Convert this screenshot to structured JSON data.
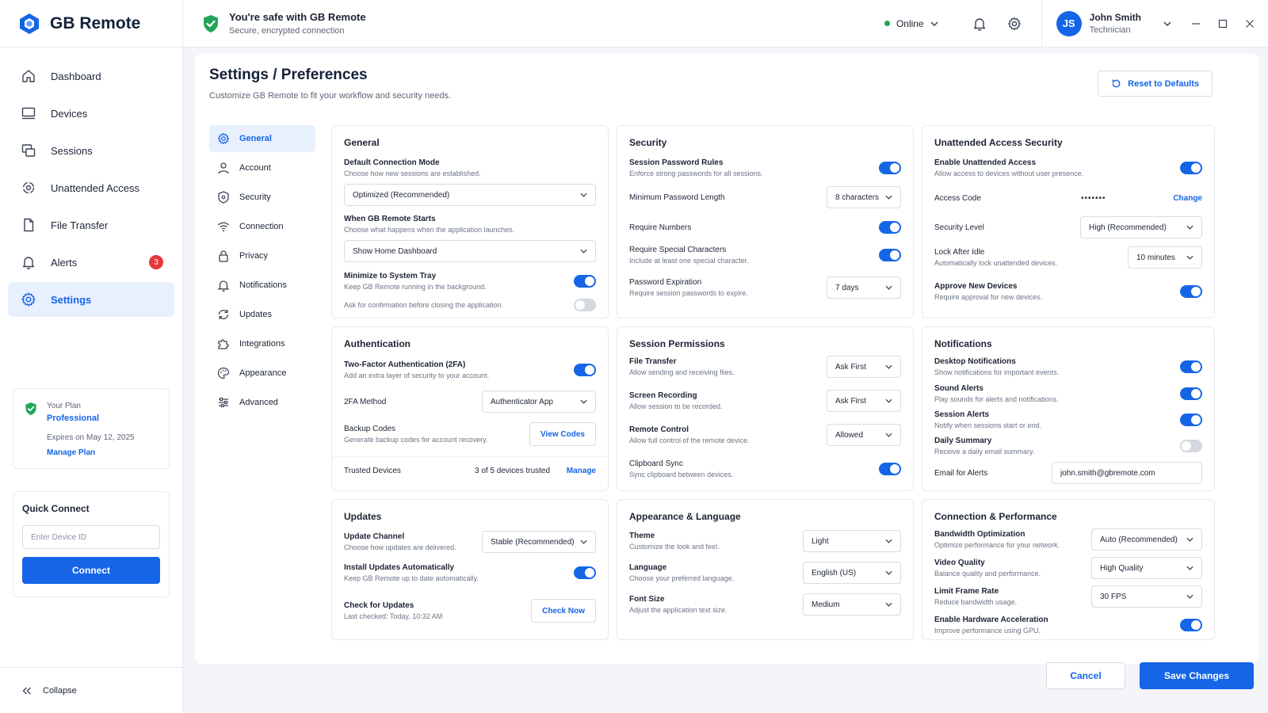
{
  "app": {
    "name": "GB Remote"
  },
  "security_banner": {
    "title": "You're safe with GB Remote",
    "subtitle": "Secure, encrypted connection"
  },
  "status": {
    "label": "Online",
    "color": "#23a55a"
  },
  "user": {
    "initials": "JS",
    "name": "John Smith",
    "role": "Technician"
  },
  "colors": {
    "accent": "#1565e6",
    "alert": "#e5383b"
  },
  "sidebar": {
    "items": [
      {
        "label": "Dashboard",
        "icon": "home-icon"
      },
      {
        "label": "Devices",
        "icon": "monitor-icon"
      },
      {
        "label": "Sessions",
        "icon": "sessions-icon"
      },
      {
        "label": "Unattended Access",
        "icon": "unattended-icon"
      },
      {
        "label": "File Transfer",
        "icon": "file-icon"
      },
      {
        "label": "Alerts",
        "icon": "bell-icon",
        "badge": "3"
      },
      {
        "label": "Settings",
        "icon": "gear-icon",
        "active": true
      }
    ],
    "plan": {
      "label": "Your Plan",
      "value": "Professional",
      "expires": "Expires on May 12, 2025",
      "manage": "Manage Plan"
    },
    "quick_connect": {
      "title": "Quick Connect",
      "placeholder": "Enter Device ID",
      "button": "Connect"
    },
    "collapse": "Collapse"
  },
  "page": {
    "title": "Settings / Preferences",
    "subtitle": "Customize GB Remote to fit your workflow and security needs.",
    "reset": "Reset to Defaults"
  },
  "subnav": [
    "General",
    "Account",
    "Security",
    "Connection",
    "Privacy",
    "Notifications",
    "Updates",
    "Integrations",
    "Appearance",
    "Advanced"
  ],
  "general": {
    "title": "General",
    "mode_label": "Default Connection Mode",
    "mode_desc": "Choose how new sessions are established.",
    "mode_value": "Optimized (Recommended)",
    "start_label": "When GB Remote Starts",
    "start_desc": "Choose what happens when the application launches.",
    "start_value": "Show Home Dashboard",
    "tray_label": "Minimize to System Tray",
    "tray_desc": "Keep GB Remote running in the background.",
    "tray_on": true,
    "confirm_label": "Ask for confirmation before closing the application.",
    "confirm_on": false
  },
  "security": {
    "title": "Security",
    "rules_label": "Session Password Rules",
    "rules_desc": "Enforce strong passwords for all sessions.",
    "rules_on": true,
    "min_label": "Minimum Password Length",
    "min_value": "8 characters",
    "num_label": "Require Numbers",
    "num_on": true,
    "special_label": "Require Special Characters",
    "special_desc": "Include at least one special character.",
    "special_on": true,
    "exp_label": "Password Expiration",
    "exp_desc": "Require session passwords to expire.",
    "exp_value": "7 days"
  },
  "unattended": {
    "title": "Unattended Access Security",
    "enable_label": "Enable Unattended Access",
    "enable_desc": "Allow access to devices without user presence.",
    "enable_on": true,
    "code_label": "Access Code",
    "code_value": "•••••••",
    "code_action": "Change",
    "level_label": "Security Level",
    "level_value": "High (Recommended)",
    "lock_label": "Lock After Idle",
    "lock_desc": "Automatically lock unattended devices.",
    "lock_value": "10 minutes",
    "approve_label": "Approve New Devices",
    "approve_desc": "Require approval for new devices.",
    "approve_on": true
  },
  "auth": {
    "title": "Authentication",
    "twofa_label": "Two-Factor Authentication (2FA)",
    "twofa_desc": "Add an extra layer of security to your account.",
    "twofa_on": true,
    "method_label": "2FA Method",
    "method_value": "Authenticator App",
    "backup_label": "Backup Codes",
    "backup_desc": "Generate backup codes for account recovery.",
    "backup_button": "View Codes",
    "trusted_label": "Trusted Devices",
    "trusted_value": "3 of 5 devices trusted",
    "trusted_action": "Manage"
  },
  "permissions": {
    "title": "Session Permissions",
    "file_label": "File Transfer",
    "file_desc": "Allow sending and receiving files.",
    "file_value": "Ask First",
    "rec_label": "Screen Recording",
    "rec_desc": "Allow session to be recorded.",
    "rec_value": "Ask First",
    "rc_label": "Remote Control",
    "rc_desc": "Allow full control of the remote device.",
    "rc_value": "Allowed",
    "clip_label": "Clipboard Sync",
    "clip_desc": "Sync clipboard between devices.",
    "clip_on": true
  },
  "notifications": {
    "title": "Notifications",
    "desktop_label": "Desktop Notifications",
    "desktop_desc": "Show notifications for important events.",
    "desktop_on": true,
    "sound_label": "Sound Alerts",
    "sound_desc": "Play sounds for alerts and notifications.",
    "sound_on": true,
    "session_label": "Session Alerts",
    "session_desc": "Notify when sessions start or end.",
    "session_on": true,
    "daily_label": "Daily Summary",
    "daily_desc": "Receive a daily email summary.",
    "daily_on": false,
    "email_label": "Email for Alerts",
    "email_value": "john.smith@gbremote.com"
  },
  "updates": {
    "title": "Updates",
    "channel_label": "Update Channel",
    "channel_desc": "Choose how updates are delivered.",
    "channel_value": "Stable (Recommended)",
    "auto_label": "Install Updates Automatically",
    "auto_desc": "Keep GB Remote up to date automatically.",
    "auto_on": true,
    "check_label": "Check for Updates",
    "check_desc": "Last checked: Today, 10:32 AM",
    "check_button": "Check Now"
  },
  "appearance": {
    "title": "Appearance & Language",
    "theme_label": "Theme",
    "theme_desc": "Customize the look and feel.",
    "theme_value": "Light",
    "lang_label": "Language",
    "lang_desc": "Choose your preferred language.",
    "lang_value": "English (US)",
    "font_label": "Font Size",
    "font_desc": "Adjust the application text size.",
    "font_value": "Medium"
  },
  "performance": {
    "title": "Connection & Performance",
    "bw_label": "Bandwidth Optimization",
    "bw_desc": "Optimize performance for your network.",
    "bw_value": "Auto (Recommended)",
    "vq_label": "Video Quality",
    "vq_desc": "Balance quality and performance.",
    "vq_value": "High Quality",
    "fr_label": "Limit Frame Rate",
    "fr_desc": "Reduce bandwidth usage.",
    "fr_value": "30 FPS",
    "hw_label": "Enable Hardware Acceleration",
    "hw_desc": "Improve performance using GPU.",
    "hw_on": true
  },
  "footer": {
    "cancel": "Cancel",
    "save": "Save Changes"
  }
}
